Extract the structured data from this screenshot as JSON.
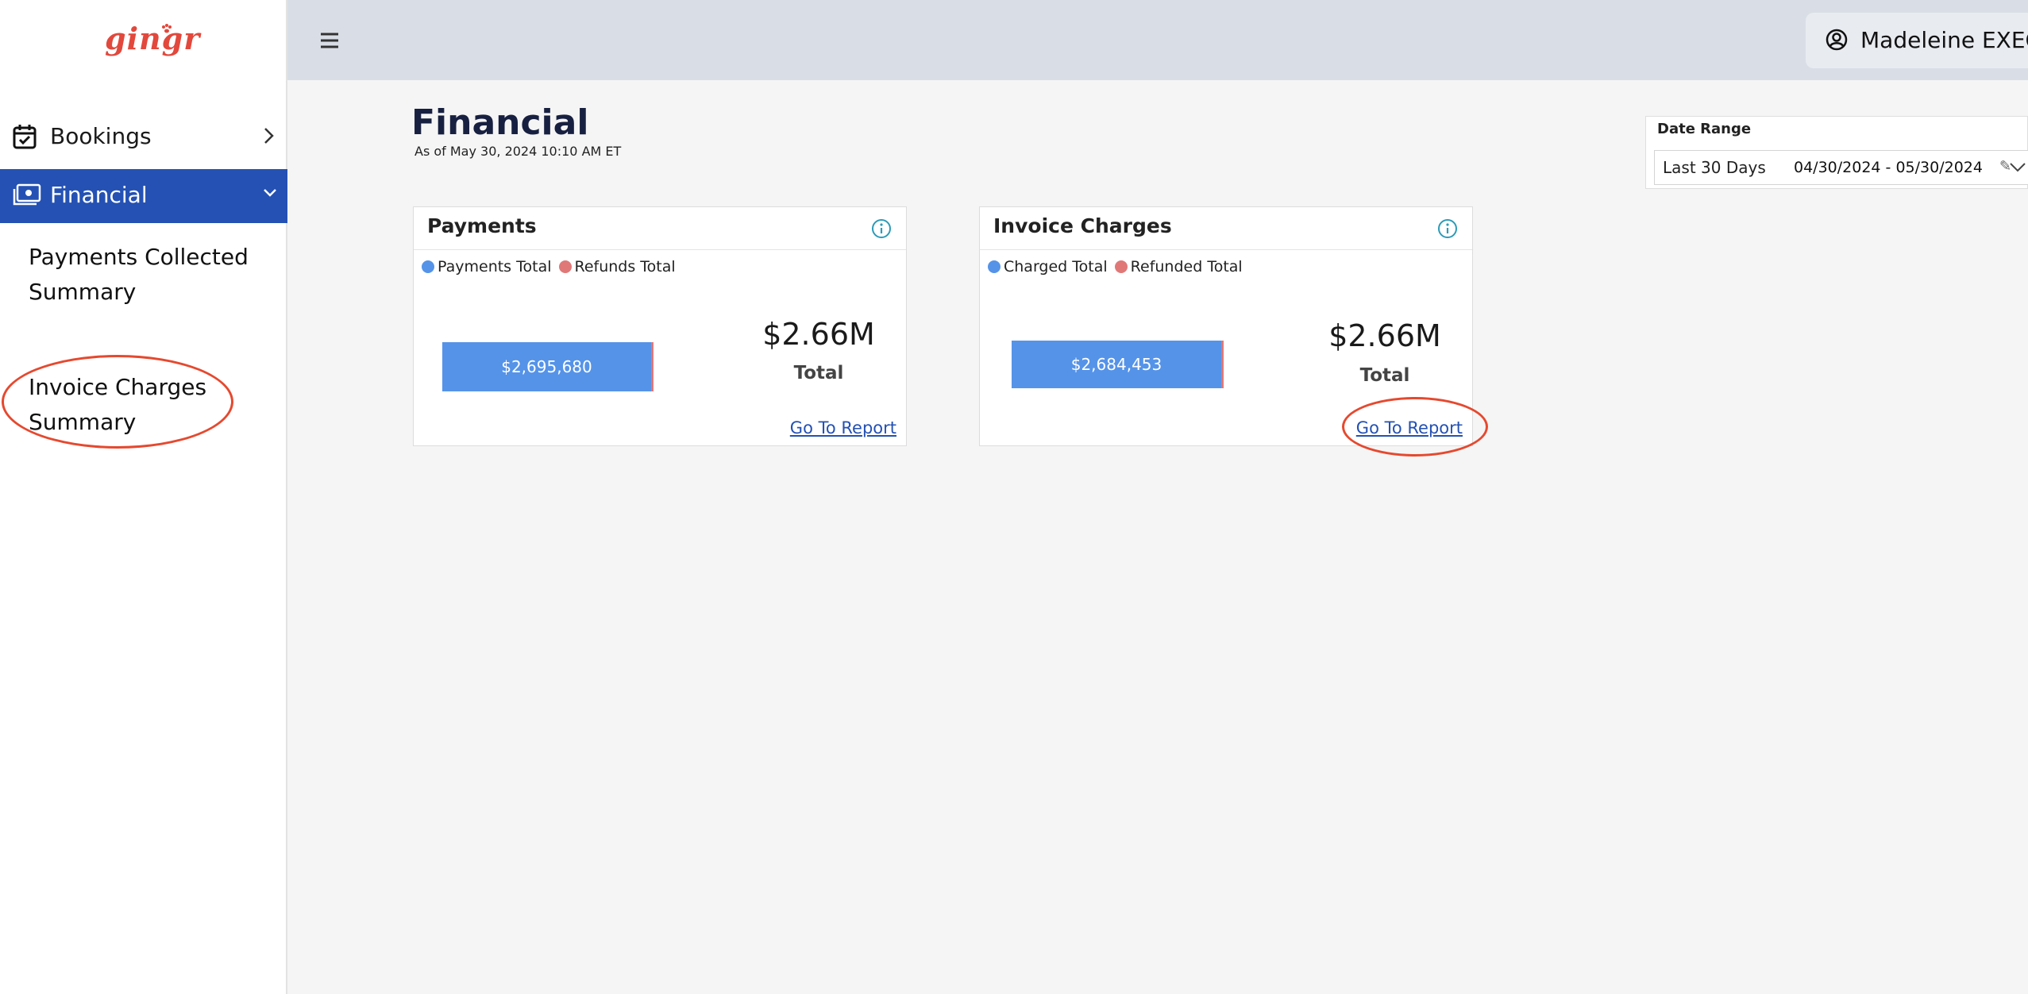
{
  "app": {
    "logo_text": "gingr"
  },
  "sidebar": {
    "items": [
      {
        "label": "Bookings",
        "icon": "calendar-check-icon"
      },
      {
        "label": "Financial",
        "icon": "money-icon",
        "active": true
      }
    ],
    "sub_items": [
      {
        "label": "Payments Collected Summary"
      },
      {
        "label": "Invoice Charges Summary"
      }
    ]
  },
  "header": {
    "user_name": "Madeleine EXEC I"
  },
  "page": {
    "title": "Financial",
    "subtitle": "As of May 30, 2024 10:10 AM ET"
  },
  "date_range": {
    "label": "Date Range",
    "preset": "Last 30 Days",
    "value": "04/30/2024 - 05/30/2024",
    "edit_glyph": "✎"
  },
  "cards": {
    "payments": {
      "title": "Payments",
      "legend": [
        {
          "name": "Payments Total",
          "color": "#5593e8"
        },
        {
          "name": "Refunds Total",
          "color": "#e07878"
        }
      ],
      "bar_label": "$2,695,680",
      "bar_fraction": 0.988,
      "total_amount": "$2.66M",
      "total_label": "Total",
      "link": "Go To Report"
    },
    "invoice": {
      "title": "Invoice Charges",
      "legend": [
        {
          "name": "Charged Total",
          "color": "#5593e8"
        },
        {
          "name": "Refunded Total",
          "color": "#e07878"
        }
      ],
      "bar_label": "$2,684,453",
      "bar_fraction": 0.992,
      "total_amount": "$2.66M",
      "total_label": "Total",
      "link": "Go To Report"
    }
  },
  "colors": {
    "accent": "#2451b3",
    "logo": "#e2483c",
    "charged": "#5593e8",
    "refund": "#e07878",
    "annotation": "#e5492f"
  }
}
